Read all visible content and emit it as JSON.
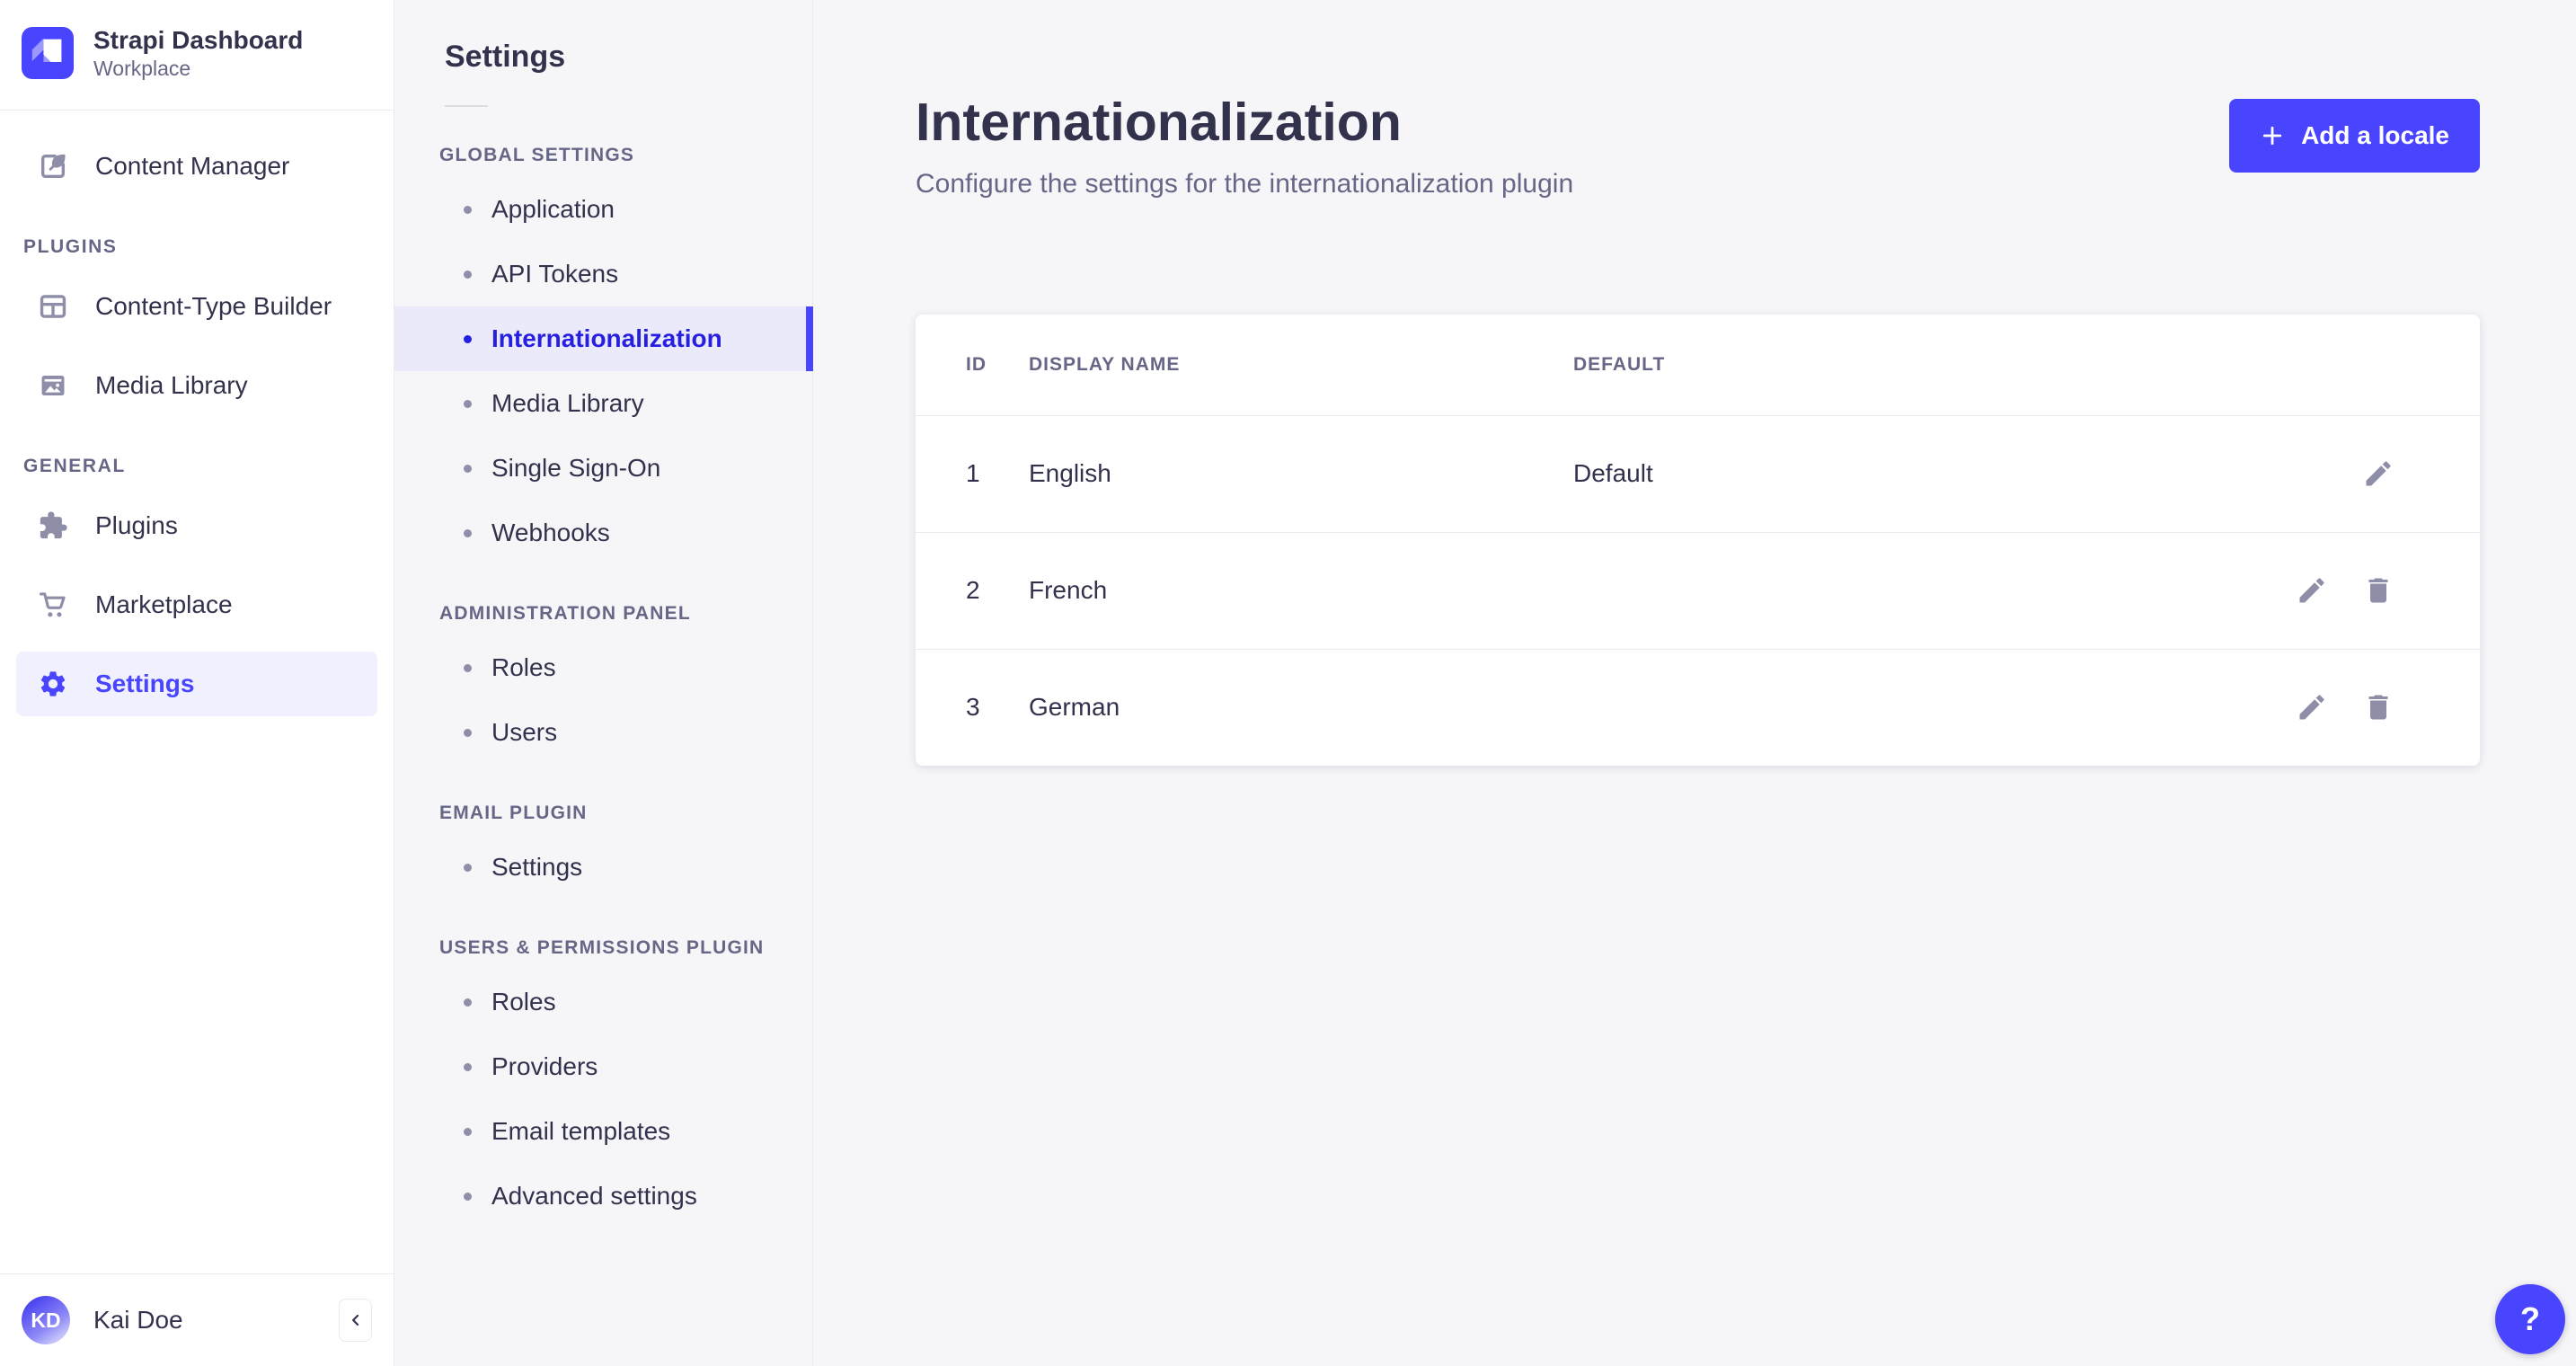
{
  "app": {
    "name": "Strapi Dashboard",
    "workspace": "Workplace",
    "user": {
      "name": "Kai Doe",
      "initials": "KD"
    }
  },
  "colors": {
    "primary": "#4945ff",
    "primary_dark": "#271fe0",
    "selected_bg": "#f0f0ff",
    "subnav_selected_bg": "#eaeafb",
    "text": "#32324d",
    "text_muted": "#666687",
    "icon_muted": "#8e8ea9",
    "border": "#eaeaef",
    "page_bg": "#f6f6f9"
  },
  "nav": {
    "sections": [
      {
        "label": "",
        "items": [
          {
            "label": "Content Manager",
            "icon": "content-manager-icon"
          }
        ]
      },
      {
        "label": "PLUGINS",
        "items": [
          {
            "label": "Content-Type Builder",
            "icon": "content-type-builder-icon"
          },
          {
            "label": "Media Library",
            "icon": "media-library-icon"
          }
        ]
      },
      {
        "label": "GENERAL",
        "items": [
          {
            "label": "Plugins",
            "icon": "plugins-icon"
          },
          {
            "label": "Marketplace",
            "icon": "marketplace-icon"
          },
          {
            "label": "Settings",
            "icon": "settings-icon",
            "active": true
          }
        ]
      }
    ]
  },
  "subnav": {
    "title": "Settings",
    "sections": [
      {
        "label": "GLOBAL SETTINGS",
        "items": [
          {
            "label": "Application"
          },
          {
            "label": "API Tokens"
          },
          {
            "label": "Internationalization",
            "active": true
          },
          {
            "label": "Media Library"
          },
          {
            "label": "Single Sign-On"
          },
          {
            "label": "Webhooks"
          }
        ]
      },
      {
        "label": "ADMINISTRATION PANEL",
        "items": [
          {
            "label": "Roles"
          },
          {
            "label": "Users"
          }
        ]
      },
      {
        "label": "EMAIL PLUGIN",
        "items": [
          {
            "label": "Settings"
          }
        ]
      },
      {
        "label": "USERS & PERMISSIONS PLUGIN",
        "items": [
          {
            "label": "Roles"
          },
          {
            "label": "Providers"
          },
          {
            "label": "Email templates"
          },
          {
            "label": "Advanced settings"
          }
        ]
      }
    ]
  },
  "main": {
    "title": "Internationalization",
    "subtitle": "Configure the settings for the internationalization plugin",
    "add_button": {
      "label": "Add a locale",
      "icon": "plus-icon"
    },
    "table": {
      "headers": {
        "id": "ID",
        "display_name": "DISPLAY NAME",
        "default": "DEFAULT"
      },
      "rows": [
        {
          "id": "1",
          "display_name": "English",
          "default": "Default",
          "actions": [
            "edit"
          ]
        },
        {
          "id": "2",
          "display_name": "French",
          "default": "",
          "actions": [
            "edit",
            "delete"
          ]
        },
        {
          "id": "3",
          "display_name": "German",
          "default": "",
          "actions": [
            "edit",
            "delete"
          ]
        }
      ]
    }
  },
  "footer": {
    "collapse_icon": "chevron-left-icon"
  },
  "help": {
    "label": "?"
  }
}
